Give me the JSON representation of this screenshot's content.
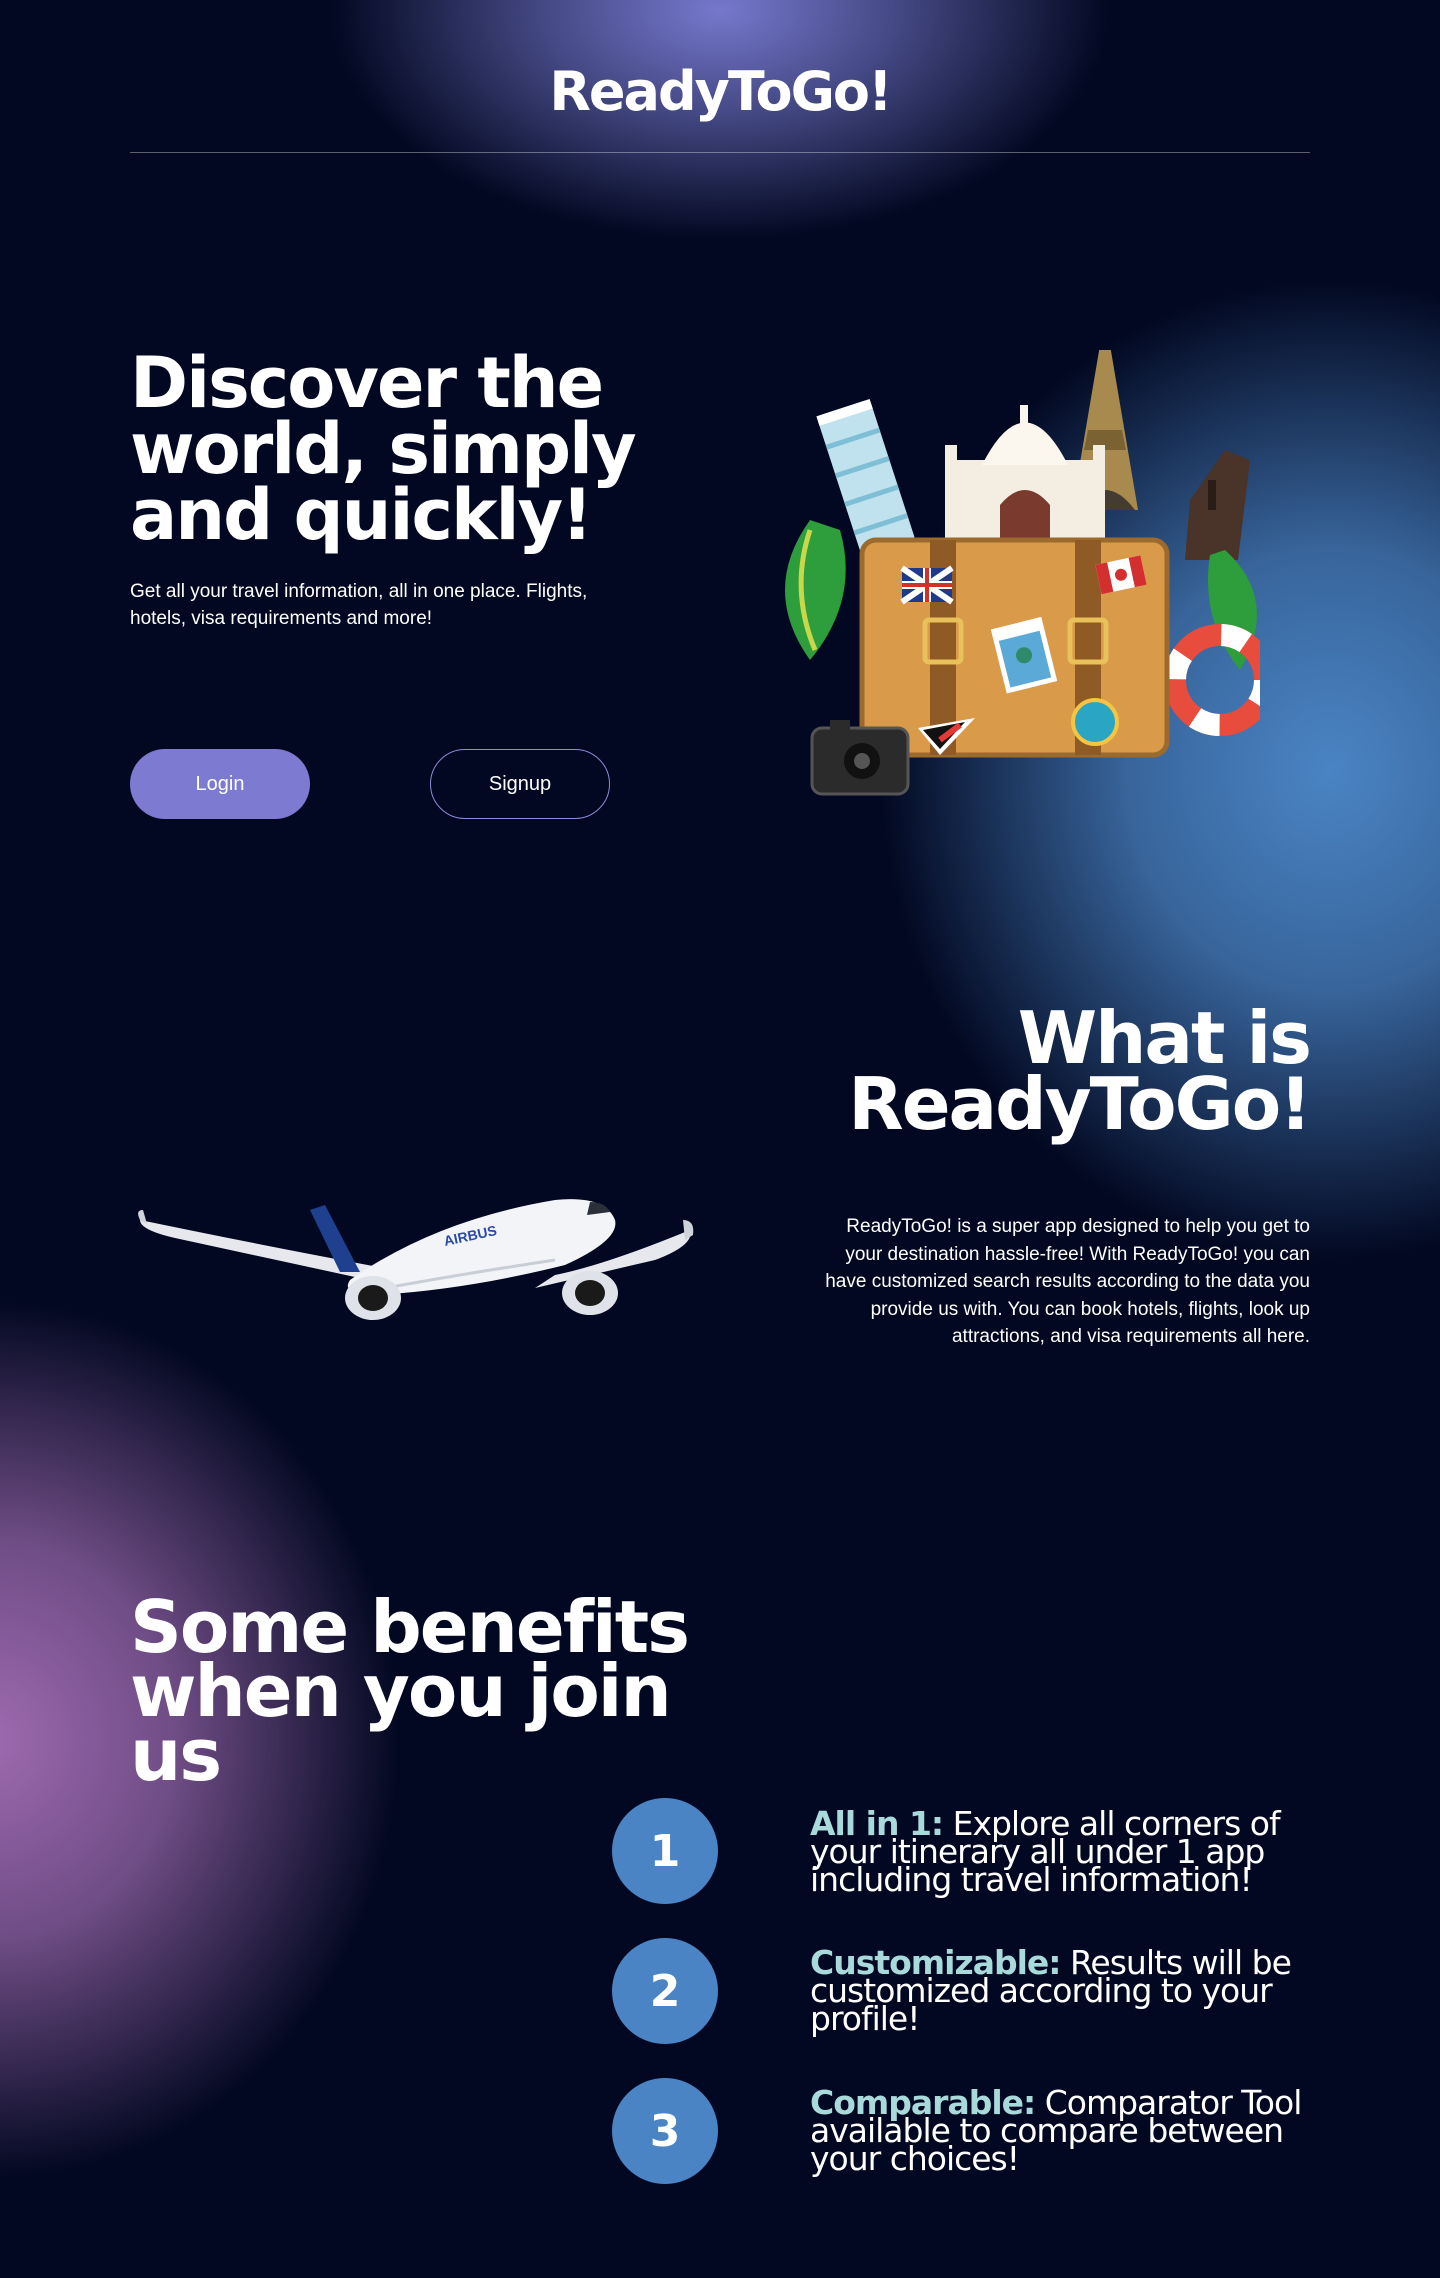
{
  "header": {
    "logo": "ReadyToGo!"
  },
  "hero": {
    "title": "Discover the world, simply and quickly!",
    "subtitle": "Get all your travel information, all in one place. Flights, hotels, visa requirements and more!",
    "login_label": "Login",
    "signup_label": "Signup"
  },
  "about": {
    "title": "What is ReadyToGo!",
    "text": "ReadyToGo! is a super app designed to help you get to your destination hassle-free! With ReadyToGo! you can have customized search results according to the data you provide us with. You can book hotels, flights, look up attractions, and visa requirements all here."
  },
  "benefits": {
    "title": "Some benefits when you join us",
    "items": [
      {
        "number": "1",
        "term": "All in 1:",
        "text": "Explore all corners of your itinerary all under 1 app including travel information!"
      },
      {
        "number": "2",
        "term": "Customizable:",
        "text": "Results will be customized according to your profile!"
      },
      {
        "number": "3",
        "term": "Comparable:",
        "text": "Comparator Tool available to compare between your choices!"
      }
    ]
  },
  "colors": {
    "background": "#020821",
    "accent_purple": "#7c7bd1",
    "accent_blue": "#4a84c4",
    "accent_mauve": "#9e6ab0",
    "highlight_teal": "#a8dadc"
  },
  "icons": {
    "hero_illustration": "travel-suitcase-landmarks-icon",
    "about_illustration": "airplane-icon"
  }
}
